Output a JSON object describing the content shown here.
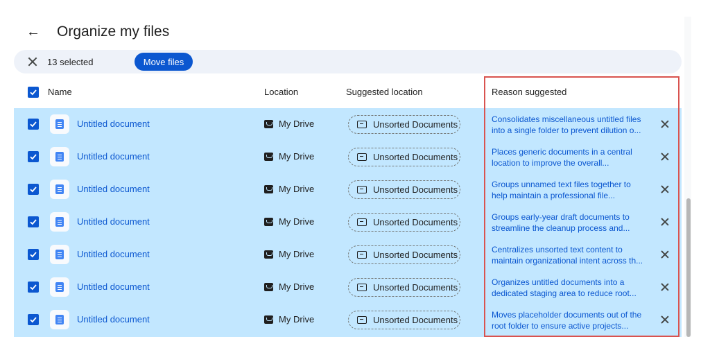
{
  "page": {
    "title": "Organize my files",
    "back_icon": "arrow-left-icon"
  },
  "selection": {
    "count_label": "13 selected",
    "move_button": "Move files"
  },
  "table": {
    "columns": {
      "name": "Name",
      "location": "Location",
      "suggested": "Suggested location",
      "reason": "Reason suggested"
    },
    "rows": [
      {
        "name": "Untitled document",
        "location": "My Drive",
        "suggested": "Unsorted Documents",
        "reason": "Consolidates miscellaneous untitled files into a single folder to prevent dilution o..."
      },
      {
        "name": "Untitled document",
        "location": "My Drive",
        "suggested": "Unsorted Documents",
        "reason": "Places generic documents in a central location to improve the overall..."
      },
      {
        "name": "Untitled document",
        "location": "My Drive",
        "suggested": "Unsorted Documents",
        "reason": "Groups unnamed text files together to help maintain a professional file..."
      },
      {
        "name": "Untitled document",
        "location": "My Drive",
        "suggested": "Unsorted Documents",
        "reason": "Groups early-year draft documents to streamline the cleanup process and..."
      },
      {
        "name": "Untitled document",
        "location": "My Drive",
        "suggested": "Unsorted Documents",
        "reason": "Centralizes unsorted text content to maintain organizational intent across th..."
      },
      {
        "name": "Untitled document",
        "location": "My Drive",
        "suggested": "Unsorted Documents",
        "reason": "Organizes untitled documents into a dedicated staging area to reduce root..."
      },
      {
        "name": "Untitled document",
        "location": "My Drive",
        "suggested": "Unsorted Documents",
        "reason": "Moves placeholder documents out of the root folder to ensure active projects..."
      }
    ]
  },
  "colors": {
    "accent": "#0b57d0",
    "selected_row": "#c2e7ff",
    "highlight_border": "#d9534f",
    "bar_bg": "#eef2f9"
  }
}
